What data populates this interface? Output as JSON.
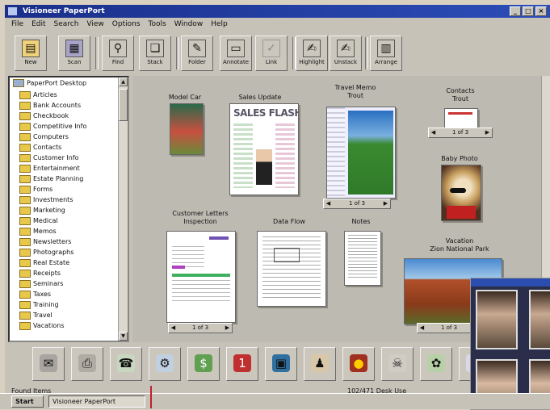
{
  "window": {
    "title": "Visioneer PaperPort"
  },
  "menu": [
    "File",
    "Edit",
    "Search",
    "View",
    "Options",
    "Tools",
    "Window",
    "Help"
  ],
  "toolbar": {
    "buttons": [
      {
        "label": "New",
        "icon": "new-page-icon"
      },
      {
        "label": "Scan",
        "icon": "scanner-icon"
      },
      {
        "label": "Find",
        "icon": "binoculars-icon"
      },
      {
        "label": "Stack",
        "icon": "stack-icon"
      },
      {
        "label": "Folder",
        "icon": "folder-icon"
      },
      {
        "label": "Annotate",
        "icon": "annotate-icon"
      },
      {
        "label": "Link",
        "icon": "link-icon"
      },
      {
        "label": "Highlight",
        "icon": "highlight-icon"
      },
      {
        "label": "Unstack",
        "icon": "unstack-icon"
      },
      {
        "label": "Arrange",
        "icon": "arrange-icon"
      }
    ]
  },
  "folders": {
    "root": "PaperPort Desktop",
    "items": [
      "Articles",
      "Bank Accounts",
      "Checkbook",
      "Competitive Info",
      "Computers",
      "Contacts",
      "Customer Info",
      "Entertainment",
      "Estate Planning",
      "Forms",
      "Investments",
      "Marketing",
      "Medical",
      "Memos",
      "Newsletters",
      "Photographs",
      "Real Estate",
      "Receipts",
      "Seminars",
      "Taxes",
      "Training",
      "Travel",
      "Vacations"
    ]
  },
  "desktop": {
    "items": [
      {
        "title": "Model Car",
        "subtitle": ""
      },
      {
        "title": "Sales Update",
        "subtitle": ""
      },
      {
        "title": "Travel Memo",
        "subtitle": "Trout"
      },
      {
        "title": "Contacts",
        "subtitle": "Trout"
      },
      {
        "title": "Baby Photo",
        "subtitle": ""
      },
      {
        "title": "Customer Letters",
        "subtitle": "Inspection"
      },
      {
        "title": "Data Flow",
        "subtitle": ""
      },
      {
        "title": "Notes",
        "subtitle": ""
      },
      {
        "title": "Vacation",
        "subtitle": "Zion National Park"
      }
    ],
    "sales_doc_text": "SALES FLASH",
    "stack_label": "1 of 3"
  },
  "launchbar": {
    "icons": [
      "mail-icon",
      "printer-icon",
      "fax-icon",
      "copier-icon",
      "dollar-icon",
      "calendar-icon",
      "photo-editor-icon",
      "ocr-icon",
      "graphics-icon",
      "trash-icon",
      "wallet-icon",
      "globe-icon"
    ]
  },
  "status": {
    "left": "Found Items",
    "right": "102/471 Desk Use"
  },
  "taskbar": {
    "start": "Start",
    "task": "Visioneer PaperPort"
  }
}
